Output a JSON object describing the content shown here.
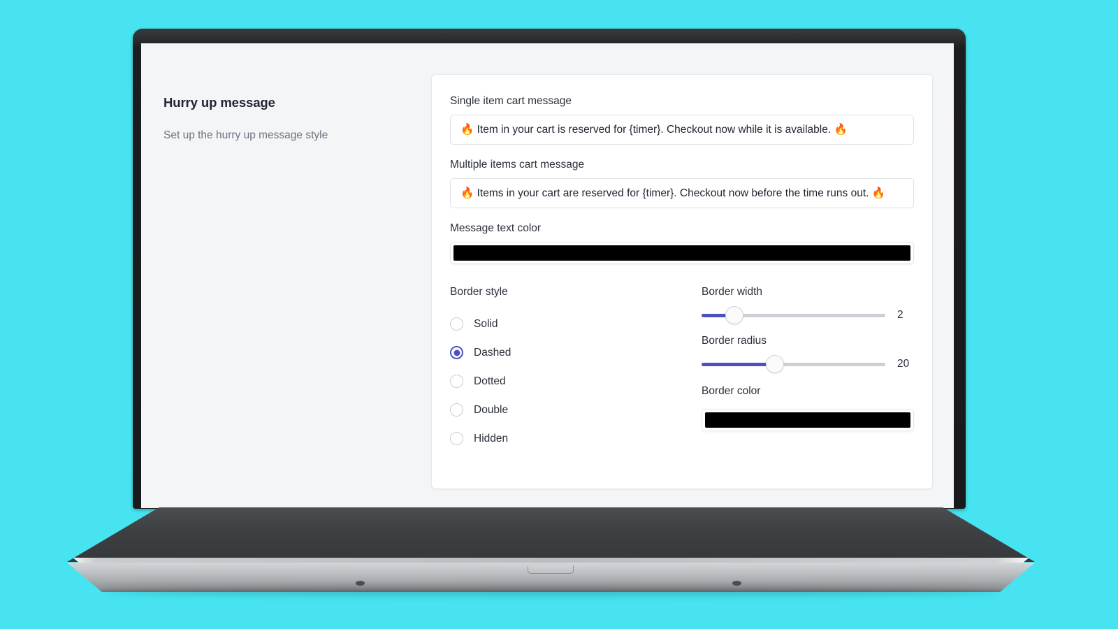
{
  "theme": {
    "background_color": "#47e3f0",
    "page_background": "#f4f5f7",
    "card_background": "#ffffff",
    "accent_color": "#4c51bf",
    "text_color": "#2b303b"
  },
  "side_panel": {
    "title": "Hurry up message",
    "subtitle": "Set up the hurry up message style"
  },
  "form": {
    "single_item": {
      "label": "Single item cart message",
      "value": "🔥 Item in your cart is reserved for {timer}. Checkout now while it is available. 🔥"
    },
    "multiple_items": {
      "label": "Multiple items cart message",
      "value": "🔥 Items in your cart are reserved for {timer}. Checkout now before the time runs out. 🔥"
    },
    "message_text_color": {
      "label": "Message text color",
      "value": "#000000"
    },
    "border_style": {
      "label": "Border style",
      "selected": "Dashed",
      "options": [
        {
          "label": "Solid",
          "selected": false
        },
        {
          "label": "Dashed",
          "selected": true
        },
        {
          "label": "Dotted",
          "selected": false
        },
        {
          "label": "Double",
          "selected": false
        },
        {
          "label": "Hidden",
          "selected": false
        }
      ]
    },
    "border_width": {
      "label": "Border width",
      "value": "2",
      "percent": 18
    },
    "border_radius": {
      "label": "Border radius",
      "value": "20",
      "percent": 40
    },
    "border_color": {
      "label": "Border color",
      "value": "#000000"
    }
  }
}
